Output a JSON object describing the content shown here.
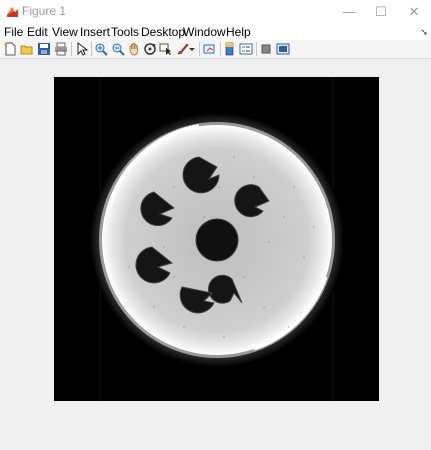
{
  "window": {
    "title": "Figure 1",
    "controls": [
      "—",
      "☐",
      "✕"
    ]
  },
  "menu": {
    "items": [
      "File",
      "Edit",
      "View",
      "Insert",
      "Tools",
      "Desktop",
      "Window",
      "Help"
    ]
  },
  "toolbar": {
    "icons": [
      "new-figure-icon",
      "open-file-icon",
      "save-icon",
      "print-icon",
      "edit-plot-arrow-icon",
      "zoom-in-icon",
      "zoom-out-icon",
      "pan-hand-icon",
      "rotate-3d-icon",
      "data-cursor-icon",
      "brush-icon",
      "link-plot-icon",
      "colorbar-icon",
      "legend-icon",
      "hide-plot-tools-icon",
      "show-plot-tools-icon"
    ]
  },
  "colors": {
    "titlebar_bg": "#ffffff",
    "window_bg": "#f0f0f0",
    "image_bg": "#000000",
    "disc_fill": "#c8c8c8",
    "disc_rim": "#ffffff"
  }
}
